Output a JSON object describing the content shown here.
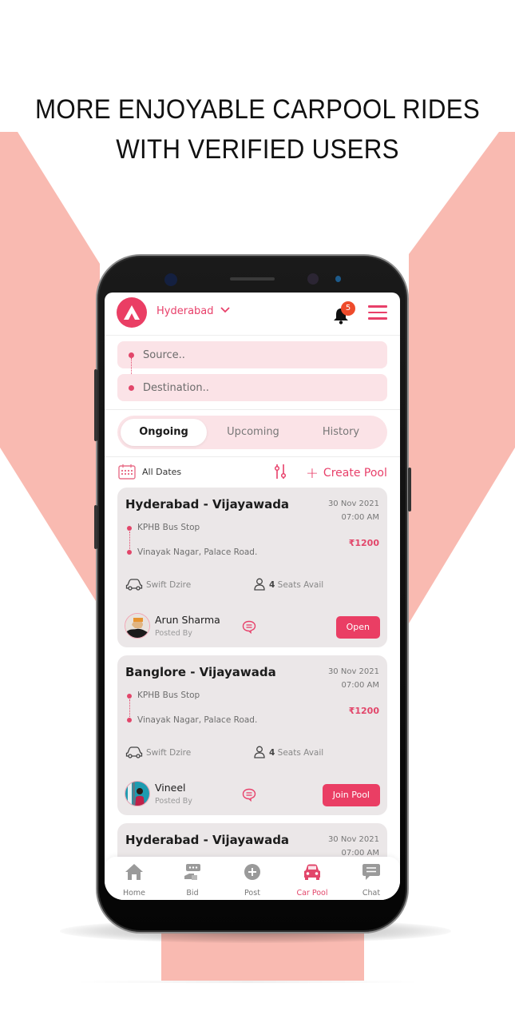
{
  "headline": {
    "line1": "MORE ENJOYABLE CARPOOL RIDES",
    "line2": "WITH VERIFIED USERS"
  },
  "colors": {
    "accent": "#ea3e64",
    "background_shape": "#f9bab1",
    "field_bg": "#fbe3e7",
    "card_bg": "#ebe7e8",
    "badge": "#ee4b2b"
  },
  "app": {
    "header": {
      "logo_icon": "app-logo-a",
      "city": "Hyderabad",
      "city_dropdown_icon": "chevron-down-icon",
      "notification_icon": "bell-icon",
      "notification_count": "5",
      "menu_icon": "hamburger-menu-icon"
    },
    "search": {
      "source_placeholder": "Source..",
      "destination_placeholder": "Destination.."
    },
    "tabs": [
      {
        "label": "Ongoing",
        "active": true
      },
      {
        "label": "Upcoming",
        "active": false
      },
      {
        "label": "History",
        "active": false
      }
    ],
    "filter": {
      "date_icon": "calendar-icon",
      "date_label": "All Dates",
      "filter_icon": "sliders-icon",
      "create_label": "Create Pool",
      "create_icon": "plus-icon"
    },
    "rides": [
      {
        "title": "Hyderabad - Vijayawada",
        "date": "30 Nov 2021",
        "time": "07:00 AM",
        "from": "KPHB Bus Stop",
        "to": "Vinayak Nagar, Palace Road.",
        "price": "₹1200",
        "car": "Swift Dzire",
        "seats_count": "4",
        "seats_label": "Seats Avail",
        "poster_name": "Arun Sharma",
        "poster_caption": "Posted By",
        "action_label": "Open"
      },
      {
        "title": "Banglore - Vijayawada",
        "date": "30 Nov 2021",
        "time": "07:00 AM",
        "from": "KPHB Bus Stop",
        "to": "Vinayak Nagar, Palace Road.",
        "price": "₹1200",
        "car": "Swift Dzire",
        "seats_count": "4",
        "seats_label": "Seats Avail",
        "poster_name": "Vineel",
        "poster_caption": "Posted By",
        "action_label": "Join Pool"
      },
      {
        "title": "Hyderabad - Vijayawada",
        "date": "30 Nov 2021",
        "time": "07:00 AM"
      }
    ],
    "bottom_nav": [
      {
        "label": "Home",
        "icon": "home-icon",
        "active": false
      },
      {
        "label": "Bid",
        "icon": "bid-icon",
        "active": false
      },
      {
        "label": "Post",
        "icon": "plus-circle-icon",
        "active": false
      },
      {
        "label": "Car Pool",
        "icon": "car-icon",
        "active": true
      },
      {
        "label": "Chat",
        "icon": "chat-icon",
        "active": false
      }
    ]
  }
}
